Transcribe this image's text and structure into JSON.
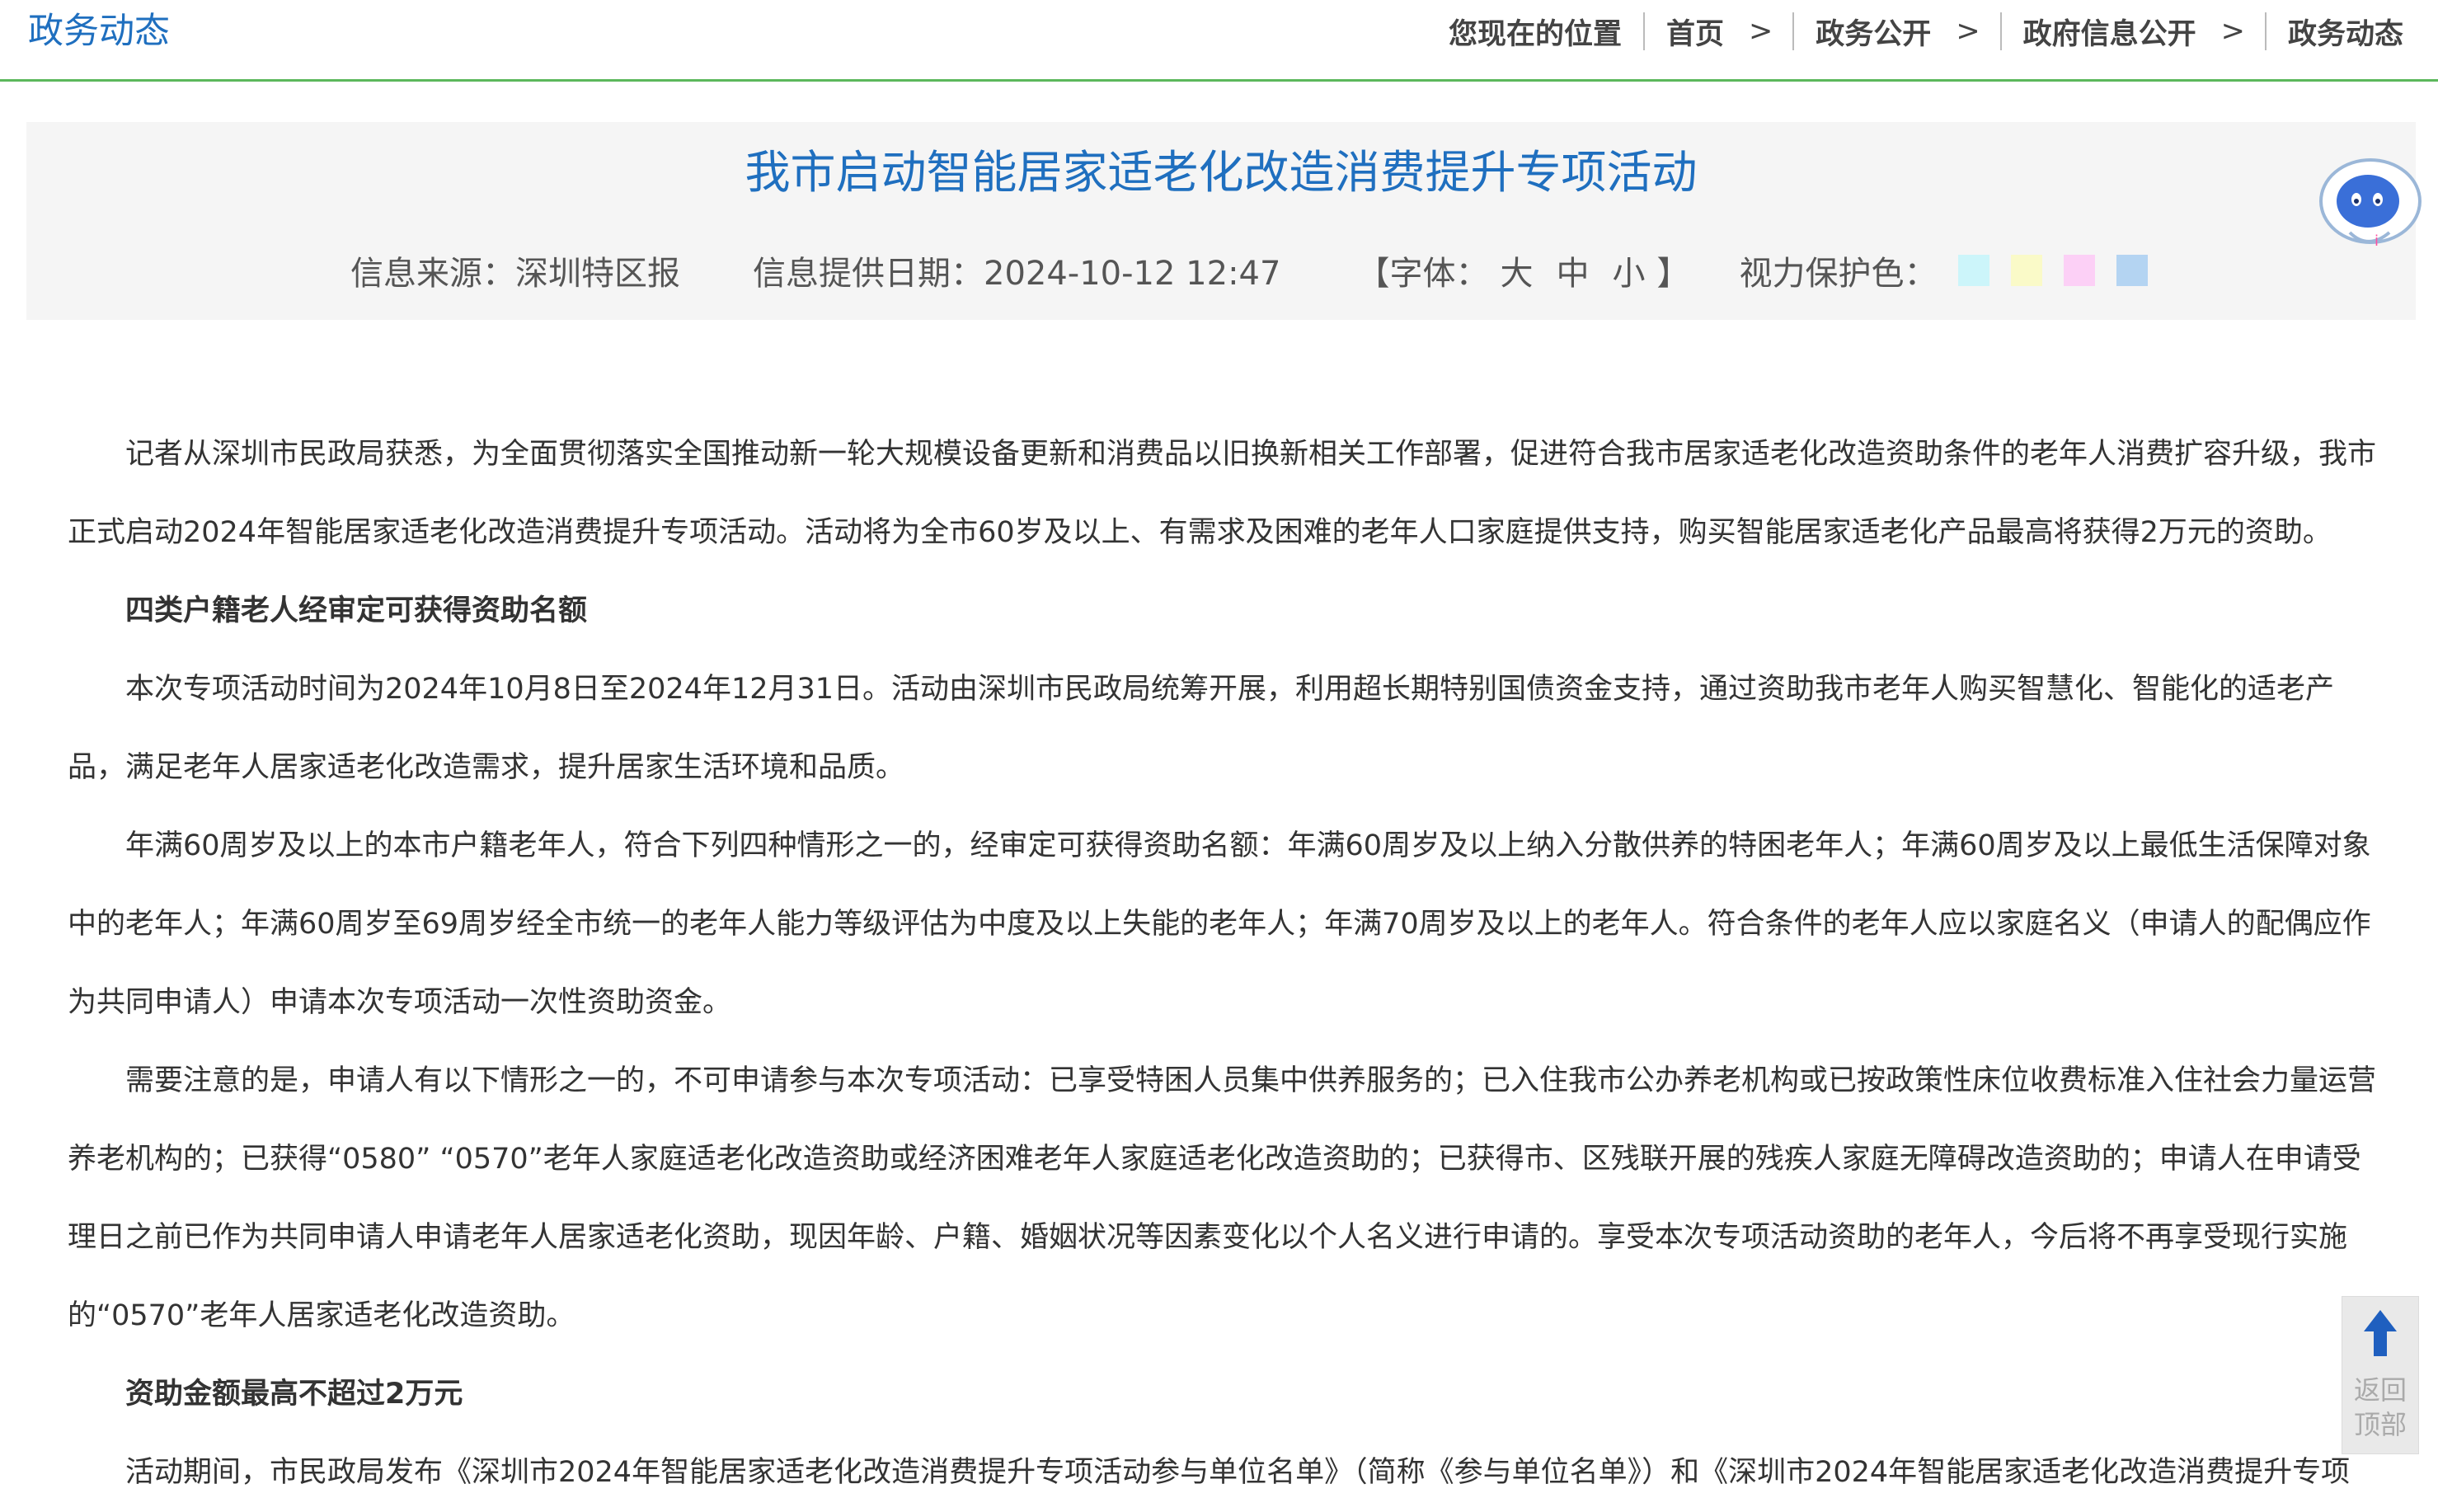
{
  "header": {
    "section_title": "政务动态",
    "breadcrumb": {
      "label": "您现在的位置",
      "items": [
        "首页",
        "政务公开",
        "政府信息公开",
        "政务动态"
      ]
    }
  },
  "article": {
    "title": "我市启动智能居家适老化改造消费提升专项活动",
    "meta": {
      "source": "信息来源：深圳特区报",
      "date": "信息提供日期：2024-10-12 12:47",
      "font_open": "【字体：",
      "font_large": "大",
      "font_medium": "中",
      "font_small": "小",
      "font_close": "】",
      "eye_care_label": "视力保护色："
    },
    "eye_care_colors": [
      "#ccf5fa",
      "#fafac8",
      "#fcd0f6",
      "#b4d4f2"
    ],
    "paragraphs": [
      "记者从深圳市民政局获悉，为全面贯彻落实全国推动新一轮大规模设备更新和消费品以旧换新相关工作部署，促进符合我市居家适老化改造资助条件的老年人消费扩容升级，我市正式启动2024年智能居家适老化改造消费提升专项活动。活动将为全市60岁及以上、有需求及困难的老年人口家庭提供支持，购买智能居家适老化产品最高将获得2万元的资助。",
      "四类户籍老人经审定可获得资助名额",
      "本次专项活动时间为2024年10月8日至2024年12月31日。活动由深圳市民政局统筹开展，利用超长期特别国债资金支持，通过资助我市老年人购买智慧化、智能化的适老产品，满足老年人居家适老化改造需求，提升居家生活环境和品质。",
      "年满60周岁及以上的本市户籍老年人，符合下列四种情形之一的，经审定可获得资助名额：年满60周岁及以上纳入分散供养的特困老年人；年满60周岁及以上最低生活保障对象中的老年人；年满60周岁至69周岁经全市统一的老年人能力等级评估为中度及以上失能的老年人；年满70周岁及以上的老年人。符合条件的老年人应以家庭名义（申请人的配偶应作为共同申请人）申请本次专项活动一次性资助资金。",
      "需要注意的是，申请人有以下情形之一的，不可申请参与本次专项活动：已享受特困人员集中供养服务的；已入住我市公办养老机构或已按政策性床位收费标准入住社会力量运营养老机构的；已获得“0580” “0570”老年人家庭适老化改造资助或经济困难老年人家庭适老化改造资助的；已获得市、区残联开展的残疾人家庭无障碍改造资助的；申请人在申请受理日之前已作为共同申请人申请老年人居家适老化资助，现因年龄、户籍、婚姻状况等因素变化以个人名义进行申请的。享受本次专项活动资助的老年人，今后将不再享受现行实施的“0570”老年人居家适老化改造资助。",
      "资助金额最高不超过2万元",
      "活动期间，市民政局发布《深圳市2024年智能居家适老化改造消费提升专项活动参与单位名单》（简称《参与单位名单》）和《深圳市2024年智能居家适老化改造消费提升专项"
    ]
  },
  "back_to_top": {
    "line1": "返回",
    "line2": "顶部"
  },
  "colors": {
    "link_blue": "#1f6fbf",
    "nav_green": "#5cb85c"
  }
}
